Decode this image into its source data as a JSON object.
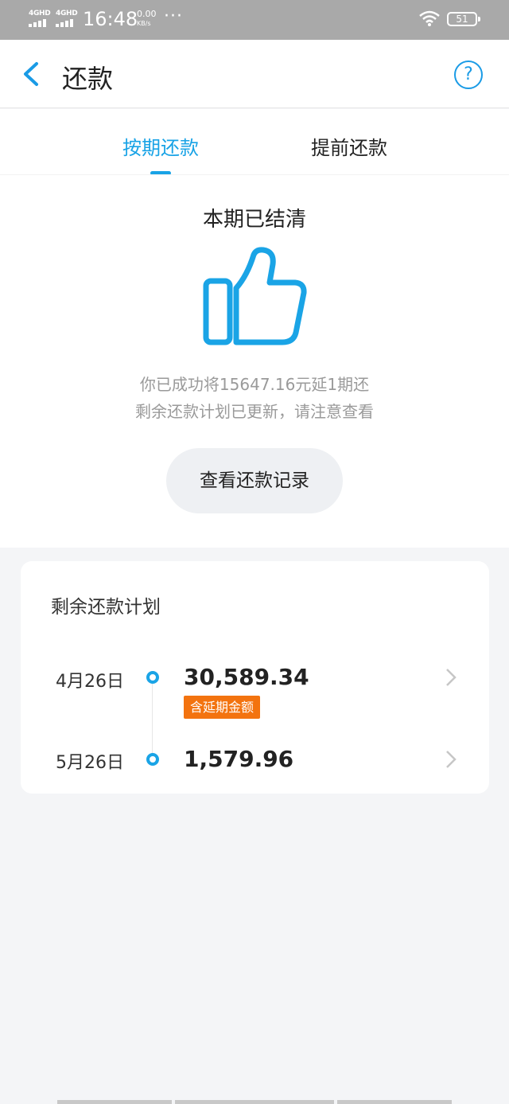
{
  "status_bar": {
    "sim1": "4GHD",
    "sim2": "4GHD",
    "time": "16:48",
    "net_speed_value": "0.00",
    "net_speed_unit": "KB/s",
    "more": "···",
    "battery": "51"
  },
  "nav": {
    "title": "还款",
    "help": "?"
  },
  "tabs": [
    {
      "label": "按期还款",
      "active": true
    },
    {
      "label": "提前还款",
      "active": false
    }
  ],
  "status": {
    "title": "本期已结清",
    "message_line1": "你已成功将15647.16元延1期还",
    "message_line2": "剩余还款计划已更新，请注意查看",
    "record_button": "查看还款记录"
  },
  "plan": {
    "title": "剩余还款计划",
    "rows": [
      {
        "date": "4月26日",
        "amount": "30,589.34",
        "badge": "含延期金额"
      },
      {
        "date": "5月26日",
        "amount": "1,579.96"
      }
    ]
  },
  "colors": {
    "accent": "#19a3e6",
    "badge": "#f3730f",
    "status_bar": "#a9a9a9",
    "background": "#f4f5f7"
  }
}
